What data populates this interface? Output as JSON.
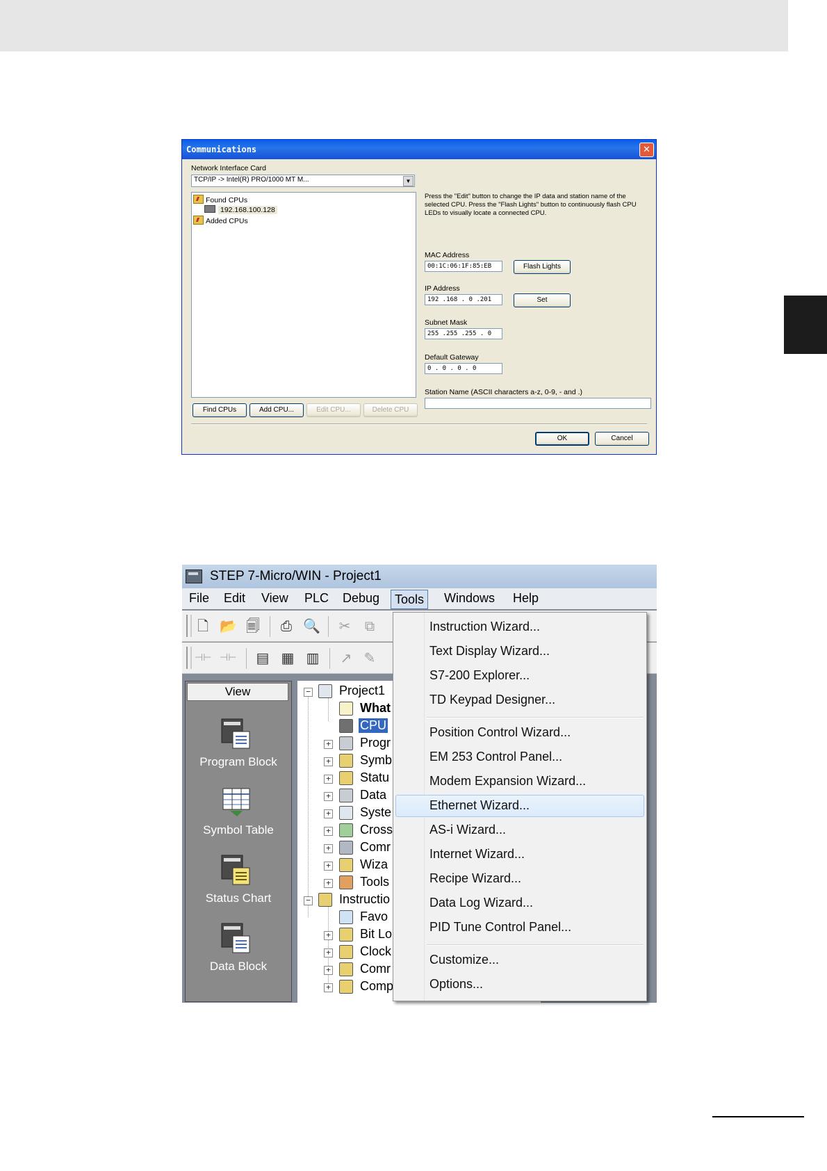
{
  "comm_dialog": {
    "title": "Communications",
    "close_glyph": "✕",
    "nic_label": "Network Interface Card",
    "nic_value": "TCP/IP -> Intel(R) PRO/1000 MT M...",
    "tree": {
      "found_cpus": "Found CPUs",
      "found_ip": "192.168.100.128",
      "added_cpus": "Added CPUs"
    },
    "help_text": "Press the \"Edit\" button to change the IP data and station name of the selected CPU. Press the \"Flash Lights\" button to continuously flash CPU LEDs to visually locate a connected CPU.",
    "mac_label": "MAC Address",
    "mac_value": "00:1C:06:1F:85:EB",
    "flash_button": "Flash Lights",
    "ip_label": "IP Address",
    "ip_value": "192 .168 .  0 .201",
    "set_button": "Set",
    "subnet_label": "Subnet Mask",
    "subnet_value": "255 .255 .255 .  0",
    "gateway_label": "Default Gateway",
    "gateway_value": "0  .  0  .  0  .  0",
    "station_label": "Station Name (ASCII characters a-z, 0-9, - and .)",
    "station_value": "",
    "buttons": {
      "find": "Find CPUs",
      "add": "Add CPU...",
      "edit": "Edit CPU...",
      "delete": "Delete CPU",
      "ok": "OK",
      "cancel": "Cancel"
    }
  },
  "step7": {
    "title": "STEP 7-Micro/WIN - Project1",
    "menu": [
      "File",
      "Edit",
      "View",
      "PLC",
      "Debug",
      "Tools",
      "Windows",
      "Help"
    ],
    "active_menu": "Tools",
    "nav_header": "View",
    "nav_items": [
      "Program Block",
      "Symbol Table",
      "Status Chart",
      "Data Block"
    ],
    "tree_items": [
      "Project1",
      "What",
      "CPU",
      "Progr",
      "Symb",
      "Statu",
      "Data",
      "Syste",
      "Cross",
      "Comr",
      "Wiza",
      "Tools",
      "Instructio",
      "Favo",
      "Bit Lo",
      "Clock",
      "Comr",
      "Comp"
    ],
    "tools_menu": {
      "group1": [
        "Instruction Wizard...",
        "Text Display Wizard...",
        "S7-200 Explorer...",
        "TD Keypad Designer..."
      ],
      "group2": [
        "Position Control Wizard...",
        "EM 253 Control Panel...",
        "Modem Expansion Wizard...",
        "Ethernet Wizard...",
        "AS-i Wizard...",
        "Internet Wizard...",
        "Recipe Wizard...",
        "Data Log Wizard...",
        "PID Tune Control Panel..."
      ],
      "group3": [
        "Customize...",
        "Options..."
      ],
      "highlighted": "Ethernet Wizard..."
    }
  }
}
